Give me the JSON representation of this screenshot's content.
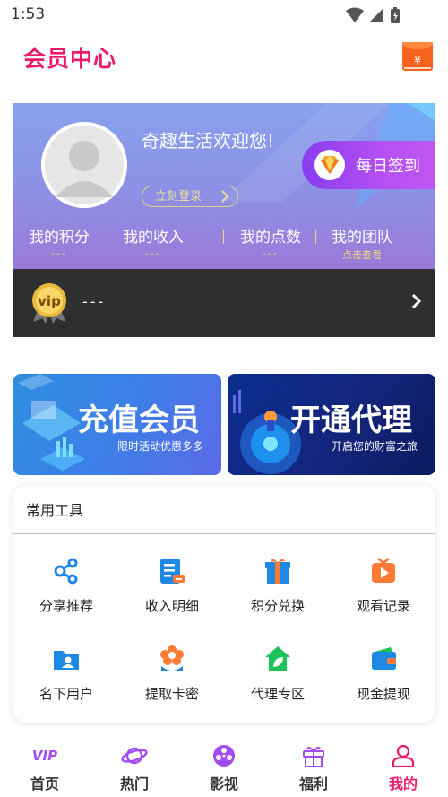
{
  "status_bar": {
    "time": "1:53"
  },
  "header": {
    "title": "会员中心",
    "envelope_symbol": "¥"
  },
  "profile": {
    "welcome": "奇趣生活欢迎您!",
    "login_label": "立刻登录",
    "checkin_label": "每日签到",
    "stats": [
      {
        "label": "我的积分",
        "value": "---"
      },
      {
        "label": "我的收入",
        "value": "---"
      },
      {
        "label": "我的点数",
        "value": "---"
      },
      {
        "label": "我的团队",
        "value": "点击查看"
      }
    ]
  },
  "vip": {
    "badge": "vip",
    "value": "---"
  },
  "banners": [
    {
      "title": "充值会员",
      "subtitle": "限时活动优惠多多"
    },
    {
      "title": "开通代理",
      "subtitle": "开启您的财富之旅"
    }
  ],
  "tools": {
    "title": "常用工具",
    "items": [
      {
        "label": "分享推荐",
        "icon": "share-icon"
      },
      {
        "label": "收入明细",
        "icon": "income-detail-icon"
      },
      {
        "label": "积分兑换",
        "icon": "gift-box-icon"
      },
      {
        "label": "观看记录",
        "icon": "play-history-icon"
      },
      {
        "label": "名下用户",
        "icon": "user-folder-icon"
      },
      {
        "label": "提取卡密",
        "icon": "flower-card-icon"
      },
      {
        "label": "代理专区",
        "icon": "agent-home-icon"
      },
      {
        "label": "现金提现",
        "icon": "wallet-icon"
      }
    ]
  },
  "tab_bar": {
    "tabs": [
      {
        "label": "首页",
        "icon": "vip-home-icon"
      },
      {
        "label": "热门",
        "icon": "planet-icon"
      },
      {
        "label": "影视",
        "icon": "film-reel-icon"
      },
      {
        "label": "福利",
        "icon": "gift-icon"
      },
      {
        "label": "我的",
        "icon": "user-icon"
      }
    ],
    "active_index": 4
  },
  "colors": {
    "brand": "#ec1a6a",
    "gold": "#f2d77a",
    "tool_blue": "#1e88e5"
  }
}
